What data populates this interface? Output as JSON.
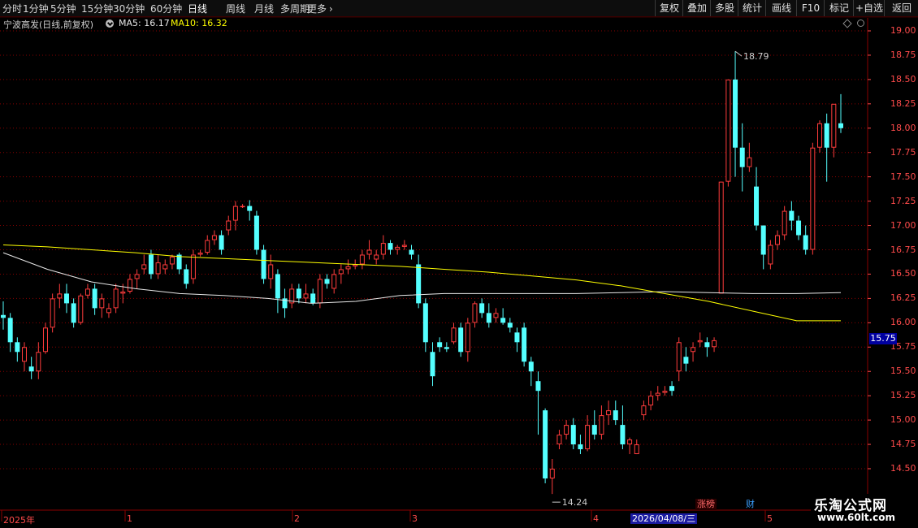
{
  "toolbar": {
    "periods": [
      "分时",
      "1分钟",
      "5分钟",
      "15分钟",
      "30分钟",
      "60分钟",
      "日线",
      "周线",
      "月线",
      "多周期",
      "更多"
    ],
    "active_period": "日线",
    "right_buttons": [
      "复权",
      "叠加",
      "多股",
      "统计",
      "画线",
      "F10",
      "标记",
      "+自选",
      "返回"
    ]
  },
  "info": {
    "stock_name": "宁波高发(日线,前复权)",
    "ma5": "MA5: 16.17",
    "ma10": "MA10: 16.32",
    "ma5_color": "#e8e8e8",
    "ma10_color": "#ffff00"
  },
  "y_axis": {
    "labels": [
      "19.00",
      "18.75",
      "18.50",
      "18.25",
      "18.00",
      "17.75",
      "17.50",
      "17.25",
      "17.00",
      "16.75",
      "16.50",
      "16.25",
      "16.00",
      "15.75",
      "15.50",
      "15.25",
      "15.00",
      "14.75",
      "14.50"
    ],
    "current_price": "15.75"
  },
  "x_axis": {
    "labels": [
      "2025年",
      "1",
      "2",
      "3",
      "4",
      "5"
    ],
    "selected_date": "2026/04/08/三"
  },
  "annotations": {
    "high": "18.79",
    "low": "14.24",
    "badge_zb": "涨榜",
    "badge_cai": "财"
  },
  "watermark": {
    "title": "乐淘公式网",
    "url": "www.60lt.com"
  },
  "colors": {
    "up": "#ff3c3c",
    "down": "#54ffff",
    "grid": "#8a0000",
    "axis_text": "#ff4b4b",
    "background": "#000000"
  },
  "chart_data": {
    "type": "candlestick",
    "ylim": [
      14.2,
      19.1
    ],
    "candles": [
      [
        16.08,
        16.22,
        15.93,
        16.05
      ],
      [
        16.05,
        16.1,
        15.7,
        15.8
      ],
      [
        15.8,
        15.85,
        15.6,
        15.7
      ],
      [
        15.6,
        15.8,
        15.5,
        15.75
      ],
      [
        15.55,
        15.65,
        15.42,
        15.5
      ],
      [
        15.5,
        15.8,
        15.42,
        15.7
      ],
      [
        15.7,
        16.0,
        15.68,
        15.95
      ],
      [
        15.95,
        16.3,
        15.9,
        16.25
      ],
      [
        16.25,
        16.4,
        16.15,
        16.3
      ],
      [
        16.3,
        16.4,
        16.1,
        16.2
      ],
      [
        16.2,
        16.25,
        15.95,
        16.0
      ],
      [
        16.0,
        16.3,
        15.98,
        16.28
      ],
      [
        16.28,
        16.4,
        16.25,
        16.35
      ],
      [
        16.35,
        16.4,
        16.08,
        16.15
      ],
      [
        16.15,
        16.3,
        16.05,
        16.25
      ],
      [
        16.1,
        16.2,
        16.05,
        16.15
      ],
      [
        16.15,
        16.4,
        16.1,
        16.35
      ],
      [
        16.3,
        16.4,
        16.2,
        16.32
      ],
      [
        16.32,
        16.5,
        16.3,
        16.45
      ],
      [
        16.45,
        16.55,
        16.35,
        16.5
      ],
      [
        16.55,
        16.7,
        16.5,
        16.6
      ],
      [
        16.7,
        16.75,
        16.45,
        16.5
      ],
      [
        16.5,
        16.7,
        16.45,
        16.62
      ],
      [
        16.55,
        16.65,
        16.5,
        16.6
      ],
      [
        16.6,
        16.7,
        16.55,
        16.68
      ],
      [
        16.7,
        16.72,
        16.5,
        16.55
      ],
      [
        16.55,
        16.6,
        16.35,
        16.4
      ],
      [
        16.45,
        16.75,
        16.4,
        16.7
      ],
      [
        16.7,
        16.75,
        16.68,
        16.72
      ],
      [
        16.72,
        16.9,
        16.7,
        16.85
      ],
      [
        16.85,
        16.95,
        16.8,
        16.9
      ],
      [
        16.9,
        16.95,
        16.7,
        16.75
      ],
      [
        16.95,
        17.1,
        16.9,
        17.05
      ],
      [
        17.05,
        17.25,
        16.95,
        17.2
      ],
      [
        17.2,
        17.22,
        17.18,
        17.2
      ],
      [
        17.2,
        17.26,
        17.05,
        17.15
      ],
      [
        17.1,
        17.15,
        16.7,
        16.75
      ],
      [
        16.75,
        16.8,
        16.4,
        16.45
      ],
      [
        16.45,
        16.7,
        16.35,
        16.6
      ],
      [
        16.5,
        16.55,
        16.1,
        16.25
      ],
      [
        16.25,
        16.35,
        16.05,
        16.15
      ],
      [
        16.2,
        16.4,
        16.15,
        16.35
      ],
      [
        16.35,
        16.4,
        16.2,
        16.25
      ],
      [
        16.25,
        16.4,
        16.2,
        16.3
      ],
      [
        16.3,
        16.35,
        16.18,
        16.2
      ],
      [
        16.2,
        16.5,
        16.15,
        16.45
      ],
      [
        16.45,
        16.5,
        16.35,
        16.4
      ],
      [
        16.35,
        16.55,
        16.3,
        16.5
      ],
      [
        16.5,
        16.6,
        16.4,
        16.55
      ],
      [
        16.55,
        16.65,
        16.5,
        16.58
      ],
      [
        16.58,
        16.65,
        16.55,
        16.6
      ],
      [
        16.6,
        16.75,
        16.55,
        16.7
      ],
      [
        16.7,
        16.85,
        16.65,
        16.75
      ],
      [
        16.65,
        16.75,
        16.6,
        16.7
      ],
      [
        16.7,
        16.9,
        16.65,
        16.82
      ],
      [
        16.82,
        16.85,
        16.7,
        16.75
      ],
      [
        16.75,
        16.8,
        16.7,
        16.78
      ],
      [
        16.78,
        16.85,
        16.75,
        16.8
      ],
      [
        16.75,
        16.8,
        16.65,
        16.7
      ],
      [
        16.6,
        16.7,
        16.15,
        16.2
      ],
      [
        16.2,
        16.25,
        15.7,
        15.8
      ],
      [
        15.7,
        15.8,
        15.35,
        15.45
      ],
      [
        15.8,
        15.85,
        15.7,
        15.75
      ],
      [
        15.75,
        15.8,
        15.7,
        15.73
      ],
      [
        15.8,
        16.0,
        15.78,
        15.95
      ],
      [
        15.95,
        16.0,
        15.65,
        15.7
      ],
      [
        15.7,
        16.05,
        15.6,
        16.0
      ],
      [
        16.0,
        16.22,
        15.95,
        16.2
      ],
      [
        16.2,
        16.25,
        16.05,
        16.1
      ],
      [
        16.1,
        16.2,
        15.95,
        16.0
      ],
      [
        16.05,
        16.15,
        16.0,
        16.1
      ],
      [
        16.05,
        16.15,
        15.98,
        16.0
      ],
      [
        16.0,
        16.05,
        15.9,
        15.95
      ],
      [
        15.9,
        15.95,
        15.7,
        15.8
      ],
      [
        15.95,
        16.0,
        15.55,
        15.6
      ],
      [
        15.6,
        15.65,
        15.35,
        15.5
      ],
      [
        15.4,
        15.5,
        14.85,
        15.3
      ],
      [
        15.1,
        15.12,
        14.35,
        14.4
      ],
      [
        14.4,
        14.6,
        14.24,
        14.5
      ],
      [
        14.75,
        14.9,
        14.7,
        14.85
      ],
      [
        14.85,
        15.0,
        14.8,
        14.95
      ],
      [
        14.95,
        15.02,
        14.7,
        14.75
      ],
      [
        14.75,
        14.85,
        14.65,
        14.7
      ],
      [
        14.7,
        15.05,
        14.68,
        14.95
      ],
      [
        14.95,
        15.1,
        14.8,
        14.85
      ],
      [
        14.85,
        15.15,
        14.8,
        15.05
      ],
      [
        15.05,
        15.2,
        14.95,
        15.1
      ],
      [
        15.1,
        15.2,
        14.95,
        15.0
      ],
      [
        14.95,
        15.15,
        14.7,
        14.75
      ],
      [
        14.75,
        14.82,
        14.65,
        14.8
      ],
      [
        14.65,
        14.8,
        14.65,
        14.75
      ],
      [
        15.05,
        15.2,
        15.0,
        15.15
      ],
      [
        15.15,
        15.3,
        15.1,
        15.25
      ],
      [
        15.25,
        15.35,
        15.2,
        15.28
      ],
      [
        15.28,
        15.35,
        15.25,
        15.3
      ],
      [
        15.35,
        15.4,
        15.25,
        15.3
      ],
      [
        15.5,
        15.85,
        15.4,
        15.8
      ],
      [
        15.65,
        15.75,
        15.5,
        15.58
      ],
      [
        15.7,
        15.8,
        15.6,
        15.75
      ],
      [
        15.8,
        15.9,
        15.75,
        15.82
      ],
      [
        15.8,
        15.85,
        15.65,
        15.75
      ],
      [
        15.75,
        15.85,
        15.7,
        15.82
      ],
      [
        16.3,
        17.45,
        16.3,
        17.45
      ],
      [
        17.45,
        18.5,
        17.4,
        18.5
      ],
      [
        18.5,
        18.79,
        17.5,
        17.8
      ],
      [
        17.8,
        18.05,
        17.35,
        17.6
      ],
      [
        17.6,
        17.85,
        17.55,
        17.7
      ],
      [
        17.4,
        17.6,
        16.95,
        17.0
      ],
      [
        17.0,
        17.0,
        16.55,
        16.7
      ],
      [
        16.6,
        16.85,
        16.55,
        16.8
      ],
      [
        16.8,
        16.95,
        16.75,
        16.9
      ],
      [
        16.9,
        17.2,
        16.85,
        17.15
      ],
      [
        17.15,
        17.25,
        16.95,
        17.05
      ],
      [
        17.05,
        17.1,
        16.85,
        16.9
      ],
      [
        16.9,
        17.0,
        16.7,
        16.75
      ],
      [
        16.75,
        17.85,
        16.7,
        17.8
      ],
      [
        17.8,
        18.08,
        17.75,
        18.05
      ],
      [
        18.05,
        18.15,
        17.45,
        17.8
      ],
      [
        17.8,
        18.25,
        17.7,
        18.25
      ],
      [
        18.05,
        18.35,
        17.95,
        18.0
      ]
    ],
    "ma_lines": [
      {
        "name": "MA5",
        "color": "#e8e8e8",
        "values": [
          16.72,
          16.55,
          16.42,
          16.35,
          16.3,
          16.28,
          16.25,
          16.2,
          16.22,
          16.28,
          16.3,
          16.3,
          16.3,
          16.3,
          16.31,
          16.32,
          16.31,
          16.3,
          16.3,
          16.31
        ]
      },
      {
        "name": "MA10",
        "color": "#ffff00",
        "values": [
          16.8,
          16.78,
          16.75,
          16.72,
          16.68,
          16.66,
          16.64,
          16.62,
          16.6,
          16.58,
          16.55,
          16.52,
          16.48,
          16.44,
          16.38,
          16.3,
          16.22,
          16.12,
          16.02,
          16.02
        ]
      }
    ]
  }
}
